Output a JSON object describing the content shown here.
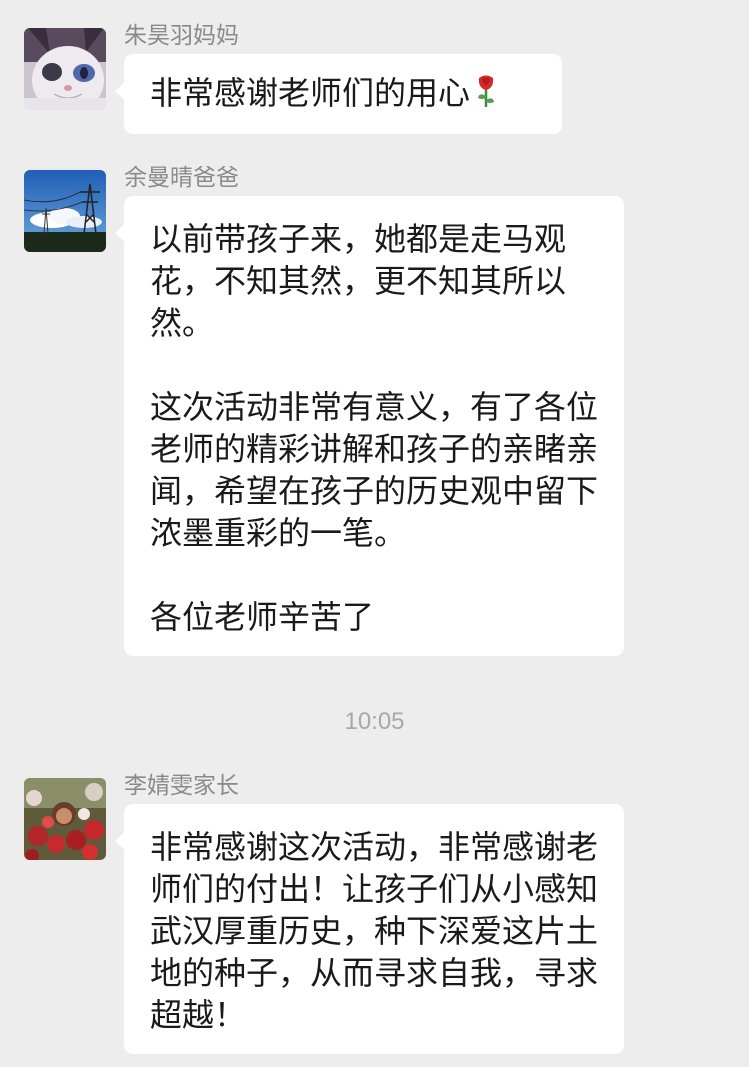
{
  "messages": [
    {
      "sender": "朱昊羽妈妈",
      "avatar_icon": "cat-avatar-icon",
      "text": "非常感谢老师们的用心",
      "emoji": "rose-icon"
    },
    {
      "sender": "余曼晴爸爸",
      "avatar_icon": "power-tower-avatar-icon",
      "paragraphs": [
        "以前带孩子来，她都是走马观花，不知其然，更不知其所以然。",
        "这次活动非常有意义，有了各位老师的精彩讲解和孩子的亲睹亲闻，希望在孩子的历史观中留下浓墨重彩的一笔。",
        "各位老师辛苦了"
      ]
    },
    {
      "sender": "李婧雯家长",
      "avatar_icon": "flowers-avatar-icon",
      "text": "非常感谢这次活动，非常感谢老师们的付出！让孩子们从小感知武汉厚重历史，种下深爱这片土地的种子，从而寻求自我，寻求超越！"
    }
  ],
  "timestamp": "10:05",
  "colors": {
    "background": "#ededed",
    "bubble": "#ffffff",
    "sender": "#8a8a8a",
    "timestamp": "#a8a8a8"
  }
}
